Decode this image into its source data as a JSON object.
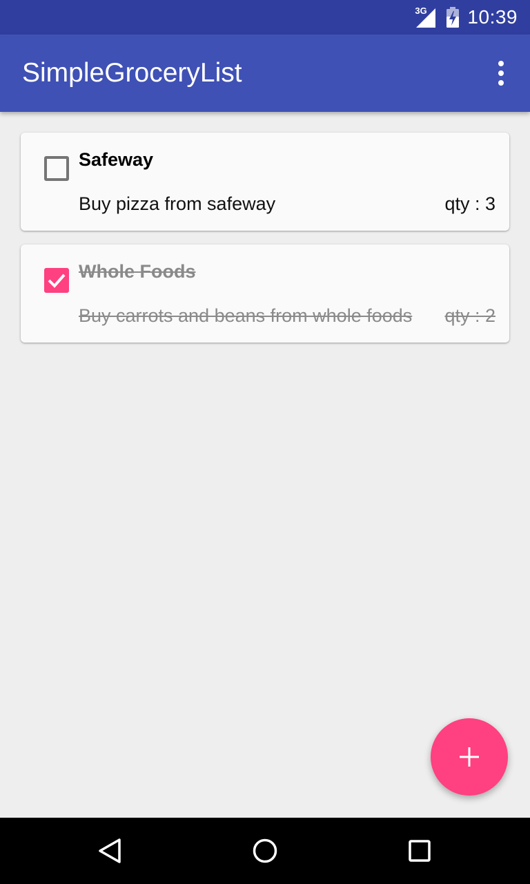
{
  "status_bar": {
    "network_type": "3G",
    "time": "10:39",
    "icons": [
      "signal-icon",
      "battery-icon"
    ]
  },
  "app_bar": {
    "title": "SimpleGroceryList",
    "menu_icon": "more-vert-icon"
  },
  "items": [
    {
      "store": "Safeway",
      "description": "Buy pizza from safeway",
      "quantity": "qty : 3",
      "checked": false
    },
    {
      "store": "Whole Foods",
      "description": "Buy carrots and beans from whole foods",
      "quantity": "qty : 2",
      "checked": true
    }
  ],
  "fab": {
    "icon": "add-icon"
  },
  "nav_bar": {
    "icons": [
      "back-icon",
      "home-icon",
      "recents-icon"
    ]
  },
  "colors": {
    "status_bar": "#303f9f",
    "app_bar": "#3f51b5",
    "accent": "#ff4081",
    "background": "#eeeeee",
    "card": "#fafafa"
  }
}
